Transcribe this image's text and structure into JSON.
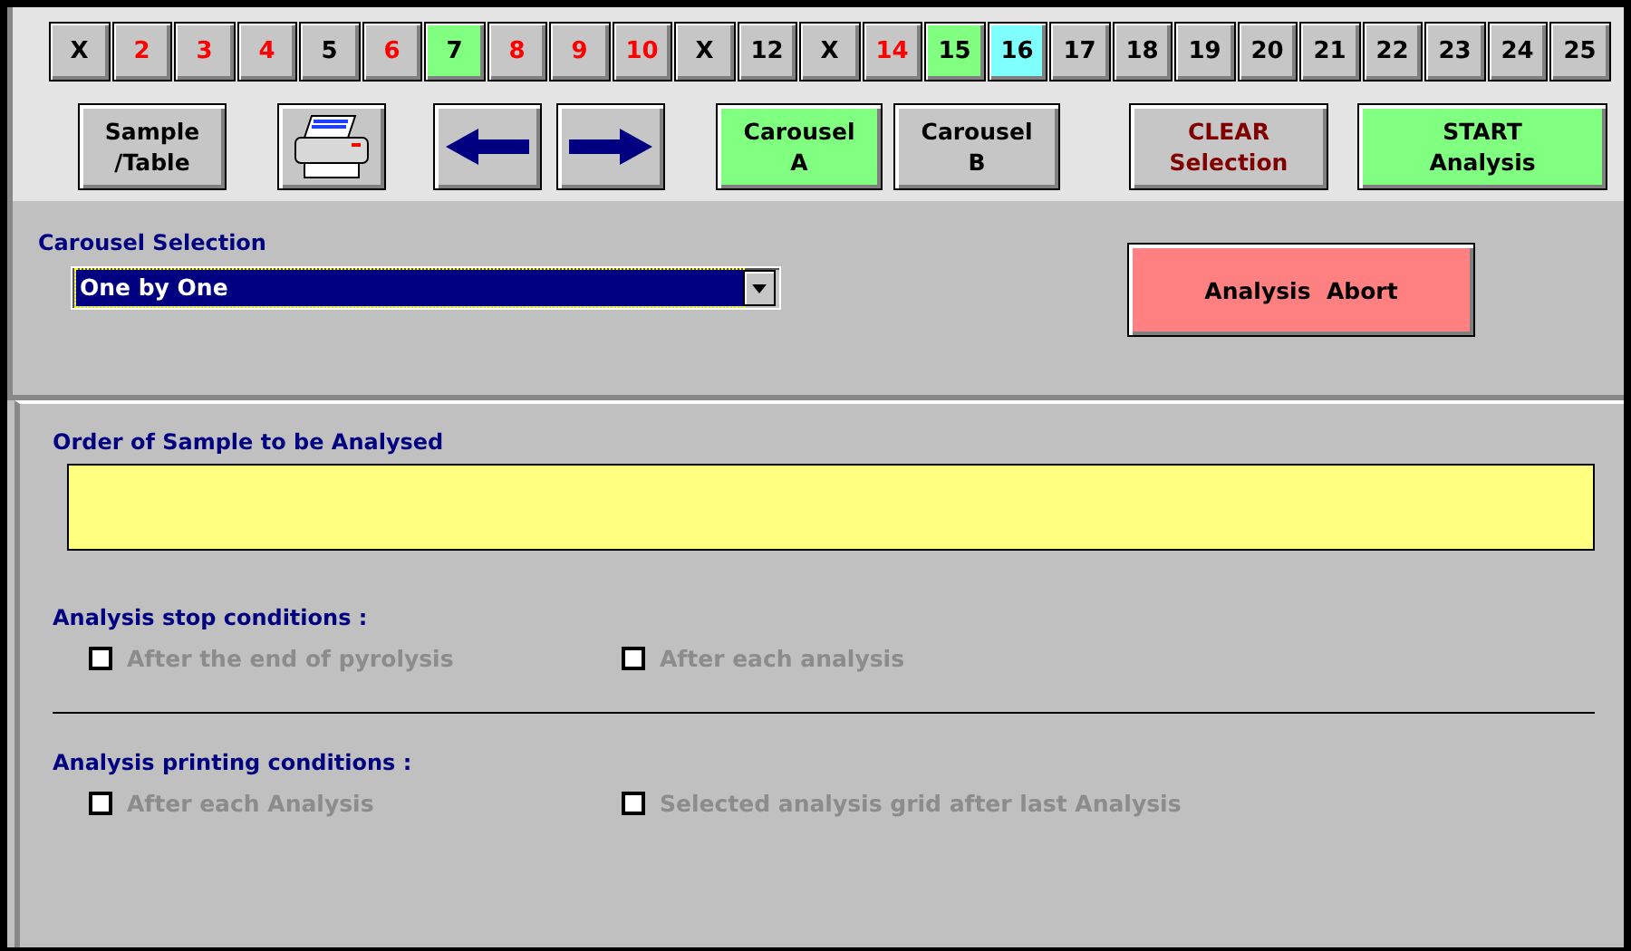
{
  "slots": [
    {
      "label": "X",
      "color": "#000000",
      "kind": "plain"
    },
    {
      "label": "2",
      "color": "#ff0000",
      "kind": "plain"
    },
    {
      "label": "3",
      "color": "#ff0000",
      "kind": "plain"
    },
    {
      "label": "4",
      "color": "#ff0000",
      "kind": "plain"
    },
    {
      "label": "5",
      "color": "#000000",
      "kind": "plain"
    },
    {
      "label": "6",
      "color": "#ff0000",
      "kind": "plain"
    },
    {
      "label": "7",
      "color": "#000000",
      "kind": "green"
    },
    {
      "label": "8",
      "color": "#ff0000",
      "kind": "plain"
    },
    {
      "label": "9",
      "color": "#ff0000",
      "kind": "plain"
    },
    {
      "label": "10",
      "color": "#ff0000",
      "kind": "plain"
    },
    {
      "label": "X",
      "color": "#000000",
      "kind": "plain"
    },
    {
      "label": "12",
      "color": "#000000",
      "kind": "plain"
    },
    {
      "label": "X",
      "color": "#000000",
      "kind": "plain"
    },
    {
      "label": "14",
      "color": "#ff0000",
      "kind": "plain"
    },
    {
      "label": "15",
      "color": "#000000",
      "kind": "green"
    },
    {
      "label": "16",
      "color": "#000000",
      "kind": "cyan"
    },
    {
      "label": "17",
      "color": "#000000",
      "kind": "plain"
    },
    {
      "label": "18",
      "color": "#000000",
      "kind": "plain"
    },
    {
      "label": "19",
      "color": "#000000",
      "kind": "plain"
    },
    {
      "label": "20",
      "color": "#000000",
      "kind": "plain"
    },
    {
      "label": "21",
      "color": "#000000",
      "kind": "plain"
    },
    {
      "label": "22",
      "color": "#000000",
      "kind": "plain"
    },
    {
      "label": "23",
      "color": "#000000",
      "kind": "plain"
    },
    {
      "label": "24",
      "color": "#000000",
      "kind": "plain"
    },
    {
      "label": "25",
      "color": "#000000",
      "kind": "plain"
    }
  ],
  "toolbar": {
    "sample_table": [
      "Sample",
      "/Table"
    ],
    "carousels": [
      {
        "lines": [
          "Carousel",
          "A"
        ],
        "selected": true
      },
      {
        "lines": [
          "Carousel",
          "B"
        ],
        "selected": false
      }
    ],
    "clear": [
      "CLEAR",
      "Selection"
    ],
    "start": [
      "START",
      "Analysis"
    ]
  },
  "carousel_selection": {
    "label": "Carousel Selection",
    "value": "One by One"
  },
  "abort_button": "Analysis  Abort",
  "order": {
    "label": "Order of Sample to be Analysed"
  },
  "stop_conditions": {
    "title": "Analysis stop conditions :",
    "options": [
      {
        "label": "After the end of pyrolysis",
        "checked": false,
        "disabled": true
      },
      {
        "label": "After each analysis",
        "checked": false,
        "disabled": true
      }
    ]
  },
  "printing_conditions": {
    "title": "Analysis printing conditions :",
    "options": [
      {
        "label": "After each Analysis",
        "checked": false,
        "disabled": true
      },
      {
        "label": "Selected analysis grid after last Analysis",
        "checked": false,
        "disabled": true
      }
    ]
  }
}
